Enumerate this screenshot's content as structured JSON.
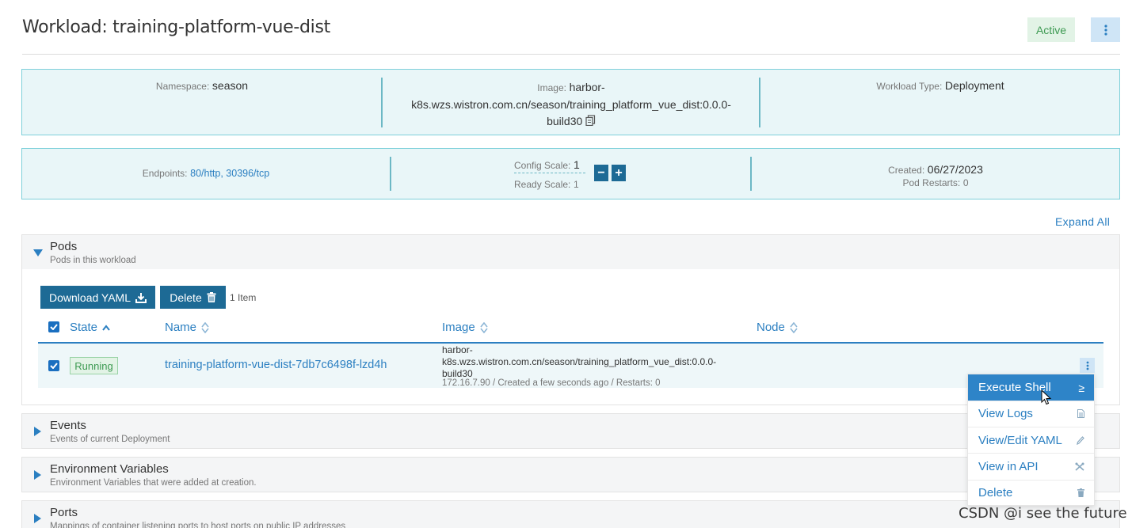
{
  "header": {
    "title": "Workload: training-platform-vue-dist",
    "status": "Active"
  },
  "info": {
    "namespace_label": "Namespace:",
    "namespace_value": "season",
    "image_label": "Image:",
    "image_value_line1": "harbor-",
    "image_value_line2": "k8s.wzs.wistron.com.cn/season/training_platform_vue_dist:0.0.0-",
    "image_value_line3": "build30",
    "workload_type_label": "Workload Type:",
    "workload_type_value": "Deployment"
  },
  "scale": {
    "endpoints_label": "Endpoints:",
    "endpoints_value": "80/http, 30396/tcp",
    "config_scale_label": "Config Scale:",
    "config_scale_value": "1",
    "ready_scale_label": "Ready Scale:",
    "ready_scale_value": "1",
    "created_label": "Created:",
    "created_value": "06/27/2023",
    "pod_restarts_label": "Pod Restarts:",
    "pod_restarts_value": "0",
    "minus_icon": "minus-icon",
    "plus_icon": "plus-icon"
  },
  "expand_all": "Expand All",
  "pods": {
    "title": "Pods",
    "subtitle": "Pods in this workload",
    "download_yaml": "Download YAML",
    "delete": "Delete",
    "item_count": "1 Item",
    "columns": {
      "state": "State",
      "name": "Name",
      "image": "Image",
      "node": "Node"
    },
    "row": {
      "state": "Running",
      "name": "training-platform-vue-dist-7db7c6498f-lzd4h",
      "image_line1": "harbor-",
      "image_line2": "k8s.wzs.wistron.com.cn/season/training_platform_vue_dist:0.0.0-",
      "image_line3": "build30",
      "meta": "172.16.7.90 / Created a few seconds ago / Restarts: 0"
    }
  },
  "sections": {
    "events_title": "Events",
    "events_subtitle": "Events of current Deployment",
    "env_title": "Environment Variables",
    "env_subtitle": "Environment Variables that were added at creation.",
    "ports_title": "Ports",
    "ports_subtitle": "Mappings of container listening ports to host ports on public IP addresses"
  },
  "menu": {
    "execute_shell": "Execute Shell",
    "view_logs": "View Logs",
    "view_edit_yaml": "View/Edit YAML",
    "view_in_api": "View in API",
    "delete": "Delete"
  },
  "watermark": "CSDN @i see the future",
  "colors": {
    "accent": "#2b7fc1",
    "dark_button": "#1d6a95",
    "success": "#3d9a52",
    "info_bg": "#e9f6f8"
  }
}
